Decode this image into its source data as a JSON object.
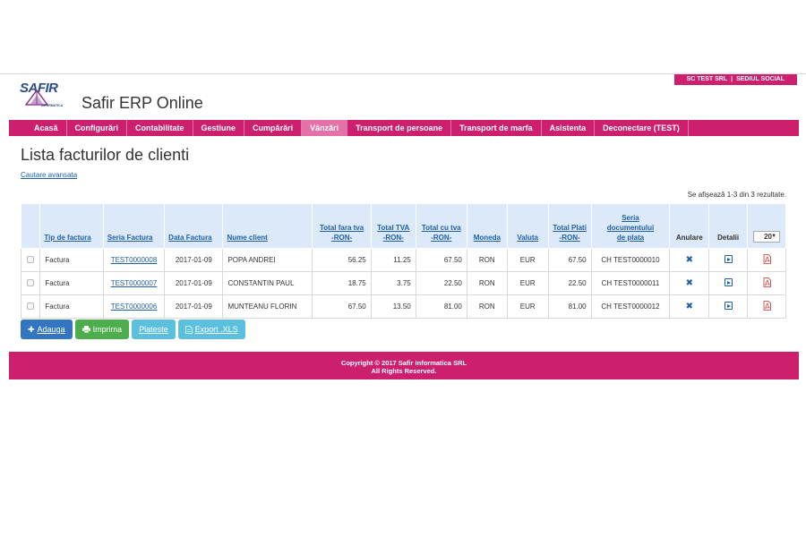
{
  "header": {
    "company": "SC TEST SRL",
    "company_sep": "|",
    "office": "SEDIUL SOCIAL",
    "logo_text": "SAFIR",
    "logo_sub": "INFORMATICA",
    "app_title": "Safir ERP Online"
  },
  "nav": {
    "items": [
      "Acasă",
      "Configurări",
      "Contabilitate",
      "Gestiune",
      "Cumpărări",
      "Vânzări",
      "Transport de persoane",
      "Transport de marfa",
      "Asistenta",
      "Deconectare (TEST)"
    ],
    "active": "Vânzări"
  },
  "main": {
    "heading": "Lista facturilor de clienti",
    "advanced_search": "Cautare avansata",
    "results_text": "Se afișează 1-3 din 3 rezultate."
  },
  "table": {
    "headers": {
      "tip": "Tip de factura",
      "seria": "Seria Factura",
      "data": "Data Factura",
      "client": "Nume client",
      "total_fara_1": "Total fara tva",
      "total_fara_2": "-RON-",
      "tva_1": "Total TVA",
      "tva_2": "-RON-",
      "total_cu_1": "Total cu tva",
      "total_cu_2": "-RON-",
      "moneda": "Moneda",
      "valuta": "Valuta",
      "plati_1": "Total Plati",
      "plati_2": "-RON-",
      "doc_1": "Seria",
      "doc_2": "documentului",
      "doc_3": "de plata",
      "anulare": "Anulare",
      "detalii": "Detalii",
      "page_size": "20"
    },
    "rows": [
      {
        "tip": "Factura",
        "seria": "TEST0000008",
        "data": "2017-01-09",
        "client": "POPA ANDREI",
        "fara": "56.25",
        "tva": "11.25",
        "cu": "67.50",
        "moneda": "RON",
        "valuta": "EUR",
        "plati": "67.50",
        "doc": "CH TEST0000010"
      },
      {
        "tip": "Factura",
        "seria": "TEST0000007",
        "data": "2017-01-09",
        "client": "CONSTANTIN PAUL",
        "fara": "18.75",
        "tva": "3.75",
        "cu": "22.50",
        "moneda": "RON",
        "valuta": "EUR",
        "plati": "22.50",
        "doc": "CH TEST0000011"
      },
      {
        "tip": "Factura",
        "seria": "TEST0000006",
        "data": "2017-01-09",
        "client": "MUNTEANU FLORIN",
        "fara": "67.50",
        "tva": "13.50",
        "cu": "81.00",
        "moneda": "RON",
        "valuta": "EUR",
        "plati": "81.00",
        "doc": "CH TEST0000012"
      }
    ]
  },
  "actions": {
    "add": "Adauga",
    "print": "Imprima",
    "pay": "Plateste",
    "export": "Export .XLS"
  },
  "footer": {
    "line1": "Copyright © 2017 Safir Informatica SRL",
    "line2": "All Rights Reserved."
  },
  "colors": {
    "brand": "#cc1f6e",
    "header_bg": "#dce9f8",
    "link": "#1f5fa5"
  }
}
